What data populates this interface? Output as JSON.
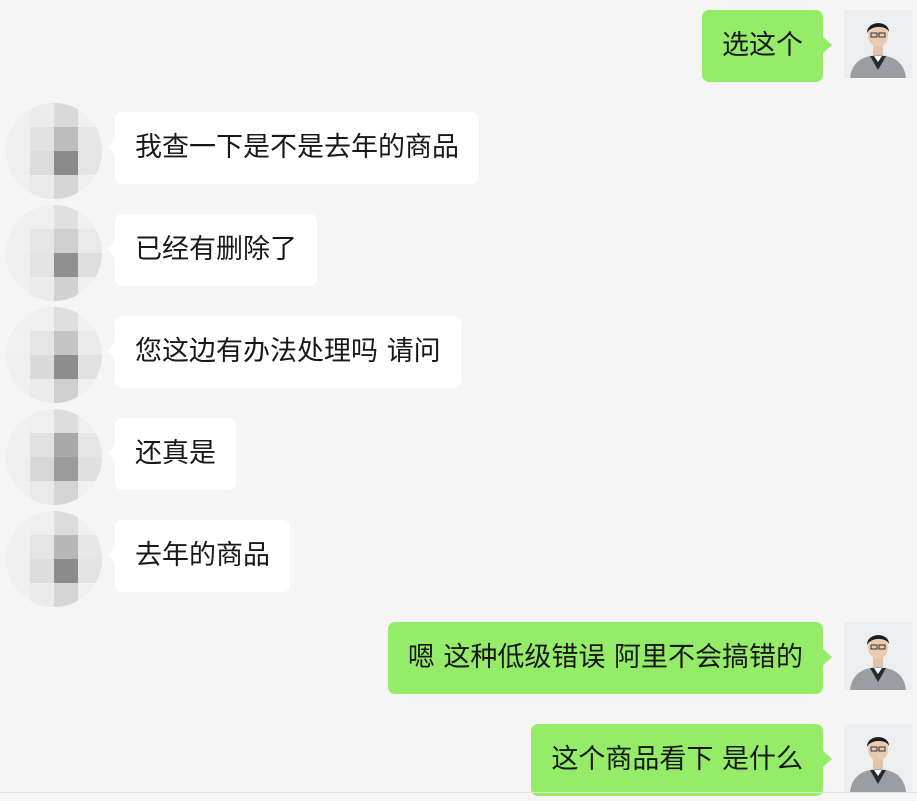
{
  "messages": [
    {
      "side": "out",
      "text": "选这个"
    },
    {
      "side": "in",
      "text": "我查一下是不是去年的商品"
    },
    {
      "side": "in",
      "text": "已经有删除了"
    },
    {
      "side": "in",
      "text": "您这边有办法处理吗 请问"
    },
    {
      "side": "in",
      "text": "还真是"
    },
    {
      "side": "in",
      "text": "去年的商品"
    },
    {
      "side": "out",
      "text": "嗯 这种低级错误 阿里不会搞错的"
    },
    {
      "side": "out",
      "text": "这个商品看下 是什么"
    }
  ],
  "colors": {
    "outgoing_bubble": "#95ec69",
    "incoming_bubble": "#ffffff",
    "background": "#f5f5f5"
  }
}
